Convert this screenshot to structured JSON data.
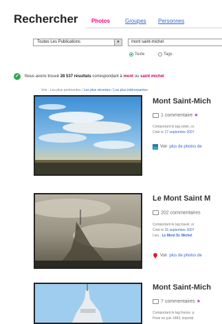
{
  "header": {
    "title": "Rechercher",
    "tabs": [
      {
        "label": "Photos",
        "active": true
      },
      {
        "label": "Groupes",
        "active": false
      },
      {
        "label": "Personnes",
        "active": false
      }
    ]
  },
  "search": {
    "scope_value": "Toutes Les Publications",
    "query_value": "mont saint-michel",
    "radio_text": "Texte",
    "radio_tags": "Tags"
  },
  "results": {
    "prefix": "Nous avons trouvé",
    "count": "28 537 résultats",
    "middle": "correspondant à",
    "term1": "mont",
    "sep": "ou",
    "term2": "saint michel"
  },
  "sortbar": {
    "label": "Voir : Les plus pertinentes",
    "opt1": "Les plus récentes",
    "opt2": "Les plus intéressantes"
  },
  "items": [
    {
      "title": "Mont Saint-Mich",
      "comments": "1 commentaire",
      "line1": "Comportant le tag soleil, co",
      "line2_prefix": "Créé le",
      "line2_date": "17 septembre 2007",
      "line3": "",
      "voir_prefix": "Voir",
      "voir_link": "plus de photos de"
    },
    {
      "title": "Le Mont Saint M",
      "comments": "202 commentaires",
      "line1": "Comportant le tag travel, st",
      "line2_prefix": "Créé le",
      "line2_date": "15 septembre 2007",
      "line3_prefix": "Lieu :",
      "line3": "Le Mont St. Michel",
      "voir_prefix": "Voir",
      "voir_link": "plus de photos de"
    },
    {
      "title": "Mont Saint-Mich",
      "comments": "7 commentaires",
      "line1": "Comportant le tag france, p",
      "line2_prefix": "Prise en juin 1983,",
      "line2_date": "importé",
      "line3": "",
      "voir_prefix": "",
      "voir_link": ""
    }
  ],
  "colors": {
    "accent_pink": "#ff0084",
    "link_blue": "#3366cc",
    "success_green": "#2fa84f"
  }
}
